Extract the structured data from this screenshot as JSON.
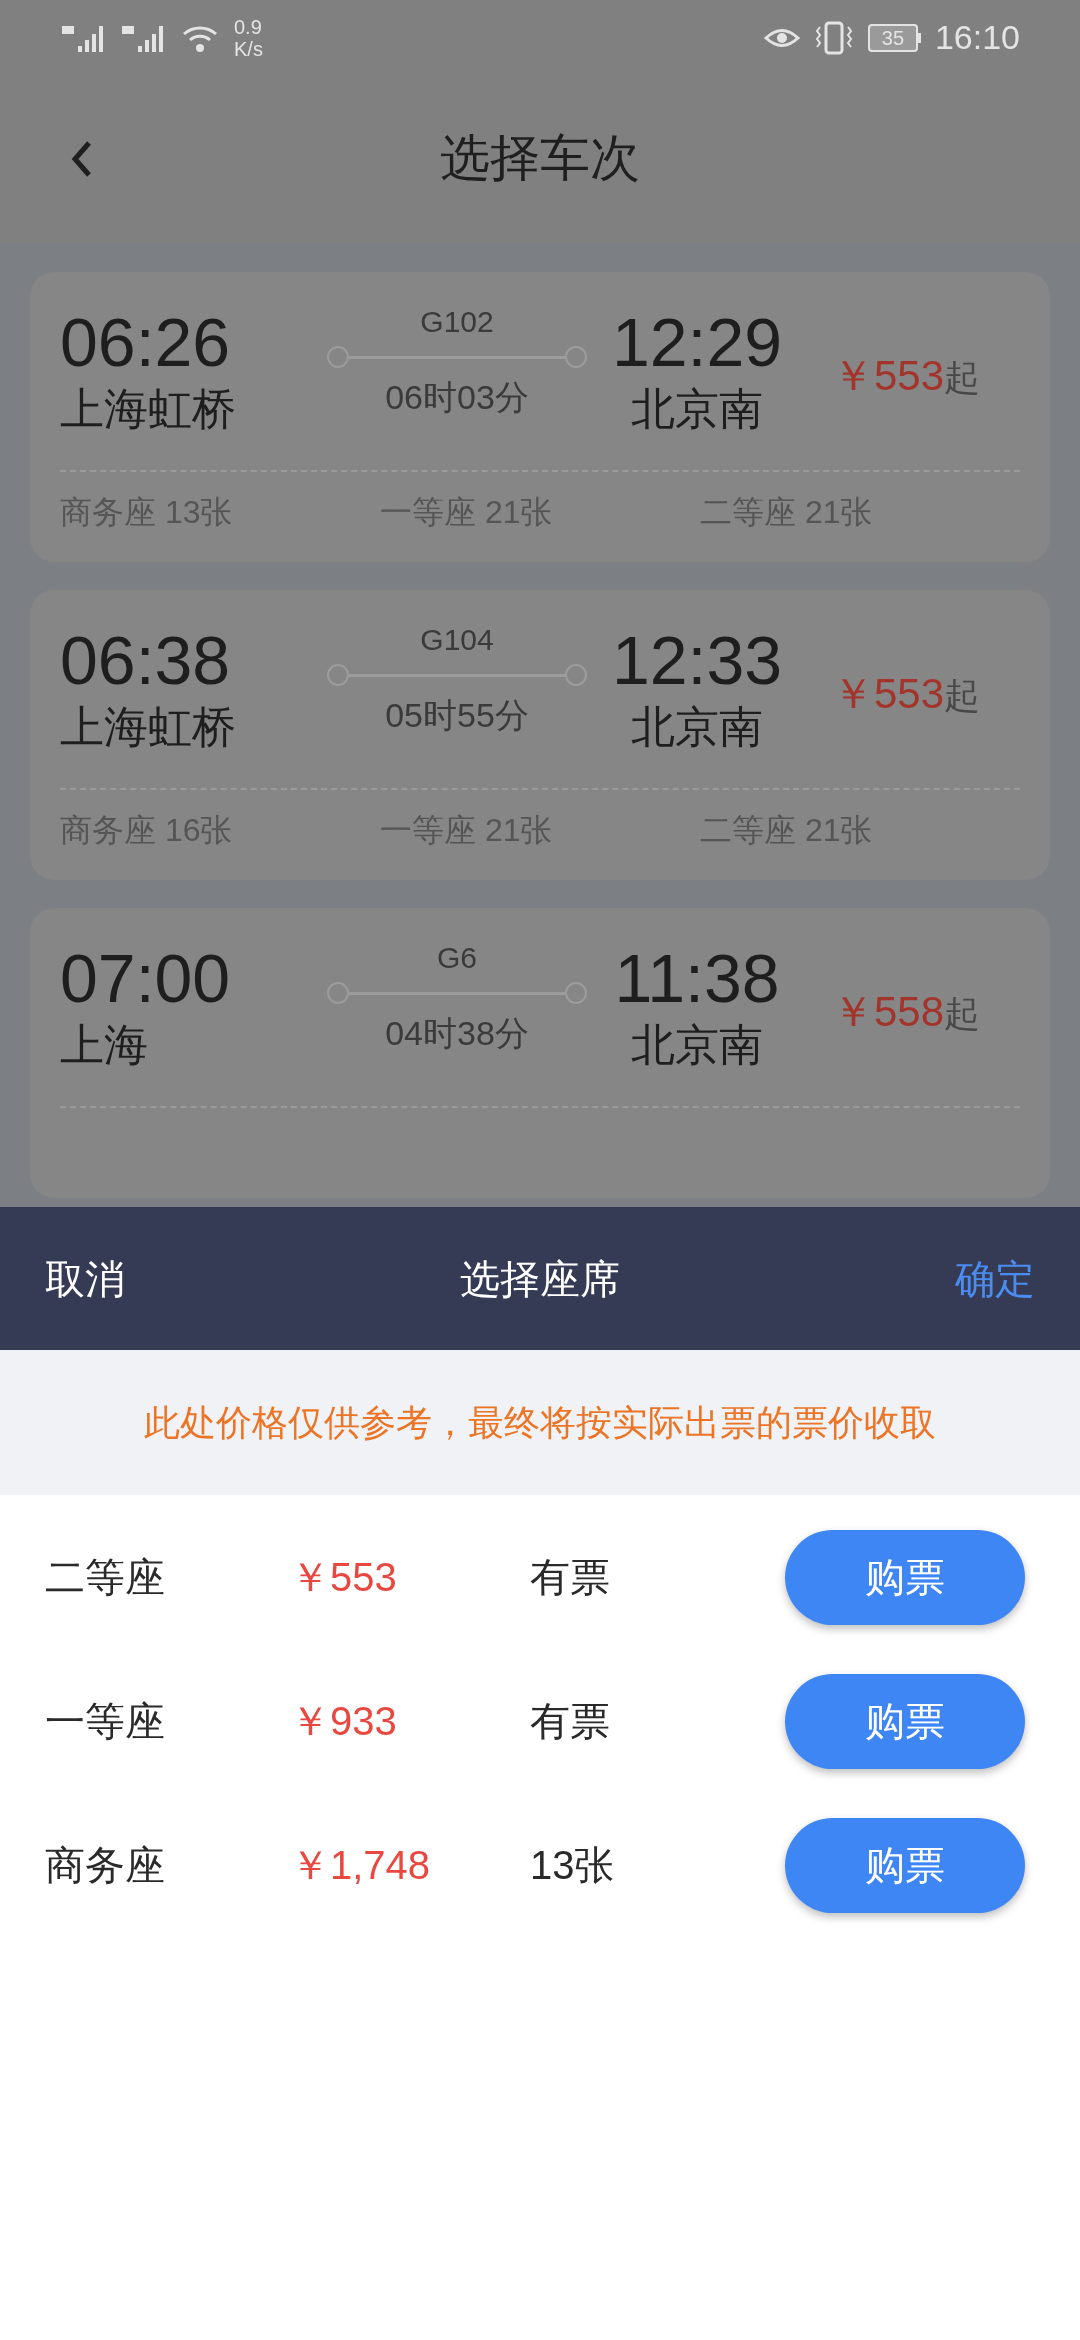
{
  "status_bar": {
    "net_speed": "0.9",
    "net_unit": "K/s",
    "battery": "35",
    "time": "16:10"
  },
  "header": {
    "title": "选择车次"
  },
  "trains": [
    {
      "depart_time": "06:26",
      "depart_station": "上海虹桥",
      "train_no": "G102",
      "duration": "06时03分",
      "arrive_time": "12:29",
      "arrive_station": "北京南",
      "price": "￥553",
      "price_suffix": "起",
      "seats": [
        "商务座 13张",
        "一等座 21张",
        "二等座 21张"
      ]
    },
    {
      "depart_time": "06:38",
      "depart_station": "上海虹桥",
      "train_no": "G104",
      "duration": "05时55分",
      "arrive_time": "12:33",
      "arrive_station": "北京南",
      "price": "￥553",
      "price_suffix": "起",
      "seats": [
        "商务座 16张",
        "一等座 21张",
        "二等座 21张"
      ]
    },
    {
      "depart_time": "07:00",
      "depart_station": "上海",
      "train_no": "G6",
      "duration": "04时38分",
      "arrive_time": "11:38",
      "arrive_station": "北京南",
      "price": "￥558",
      "price_suffix": "起"
    }
  ],
  "seat_sheet": {
    "cancel": "取消",
    "title": "选择座席",
    "confirm": "确定",
    "notice": "此处价格仅供参考，最终将按实际出票的票价收取",
    "rows": [
      {
        "seat": "二等座",
        "price": "￥553",
        "availability": "有票",
        "button": "购票"
      },
      {
        "seat": "一等座",
        "price": "￥933",
        "availability": "有票",
        "button": "购票"
      },
      {
        "seat": "商务座",
        "price": "￥1,748",
        "availability": "13张",
        "button": "购票"
      }
    ]
  }
}
